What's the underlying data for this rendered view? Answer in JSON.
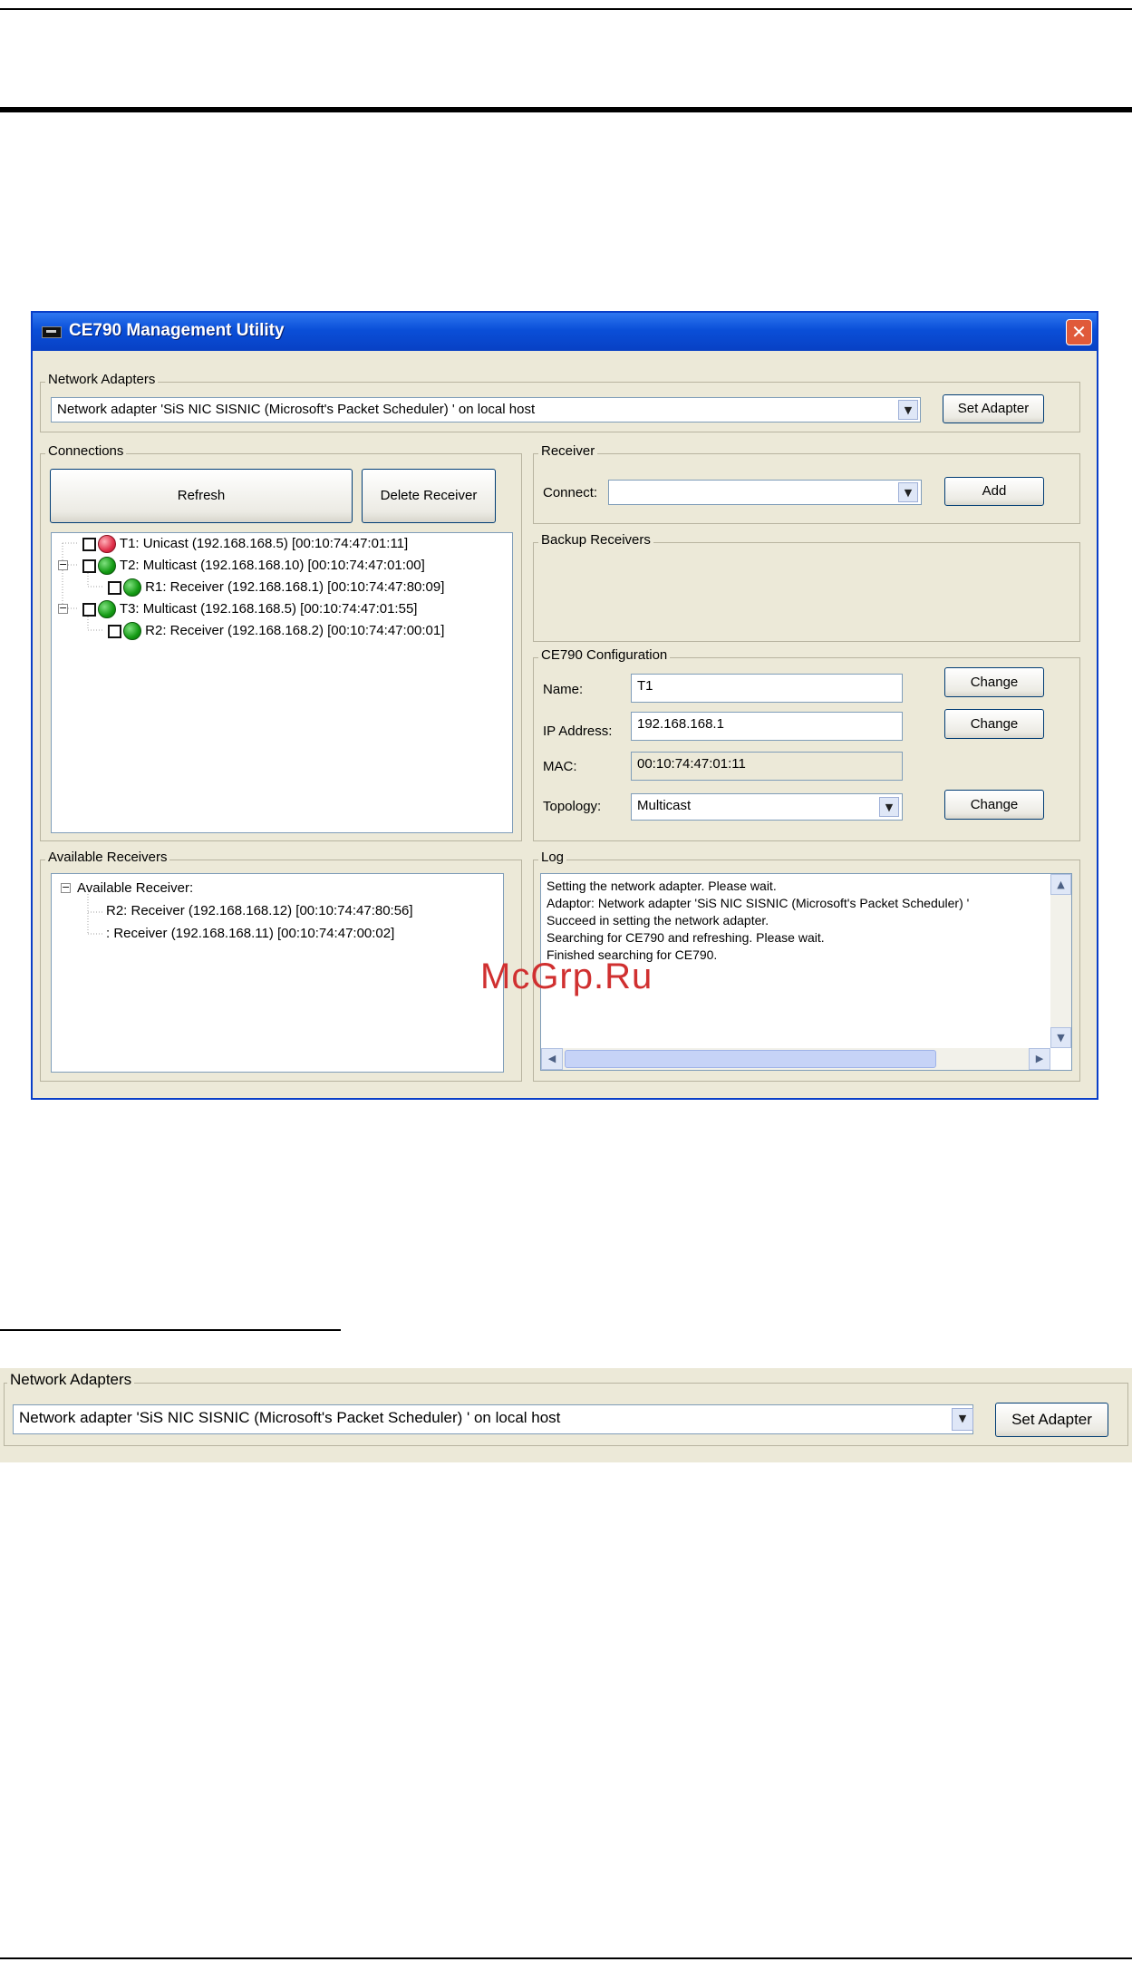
{
  "window": {
    "title": "CE790 Management Utility",
    "close_glyph": "✕"
  },
  "network_adapters": {
    "label": "Network Adapters",
    "selected": "Network adapter 'SiS NIC SISNIC (Microsoft's Packet Scheduler) ' on local host",
    "set_button": "Set Adapter"
  },
  "connections": {
    "label": "Connections",
    "refresh_button": "Refresh",
    "delete_button": "Delete Receiver",
    "tree": [
      {
        "text": "T1: Unicast (192.168.168.5) [00:10:74:47:01:11]",
        "status": "red"
      },
      {
        "text": "T2: Multicast (192.168.168.10) [00:10:74:47:01:00]",
        "status": "green"
      },
      {
        "text": "R1: Receiver (192.168.168.1) [00:10:74:47:80:09]",
        "status": "green"
      },
      {
        "text": "T3: Multicast (192.168.168.5) [00:10:74:47:01:55]",
        "status": "green"
      },
      {
        "text": "R2: Receiver (192.168.168.2) [00:10:74:47:00:01]",
        "status": "green"
      }
    ]
  },
  "receiver": {
    "label": "Receiver",
    "connect_label": "Connect:",
    "connect_value": "",
    "add_button": "Add"
  },
  "backup_receivers": {
    "label": "Backup Receivers"
  },
  "config": {
    "label": "CE790 Configuration",
    "name_label": "Name:",
    "name_value": "T1",
    "ip_label": "IP Address:",
    "ip_value": "192.168.168.1",
    "mac_label": "MAC:",
    "mac_value": "00:10:74:47:01:11",
    "topology_label": "Topology:",
    "topology_value": "Multicast",
    "change_button": "Change"
  },
  "available_receivers": {
    "label": "Available Receivers",
    "root": "Available Receiver:",
    "items": [
      "R2: Receiver (192.168.168.12) [00:10:74:47:80:56]",
      ": Receiver (192.168.168.11) [00:10:74:47:00:02]"
    ]
  },
  "log": {
    "label": "Log",
    "lines": [
      "Setting the network adapter. Please wait.",
      "Adaptor: Network adapter 'SiS NIC SISNIC (Microsoft's Packet Scheduler) '",
      "Succeed in setting the network adapter.",
      "Searching for CE790 and refreshing. Please wait.",
      "Finished searching for CE790."
    ]
  },
  "watermark": "McGrp.Ru",
  "colors": {
    "titlebar": "#0a4fd8",
    "window_bg": "#ece9d8",
    "status_green": "#139a13",
    "status_red": "#e0304a"
  }
}
